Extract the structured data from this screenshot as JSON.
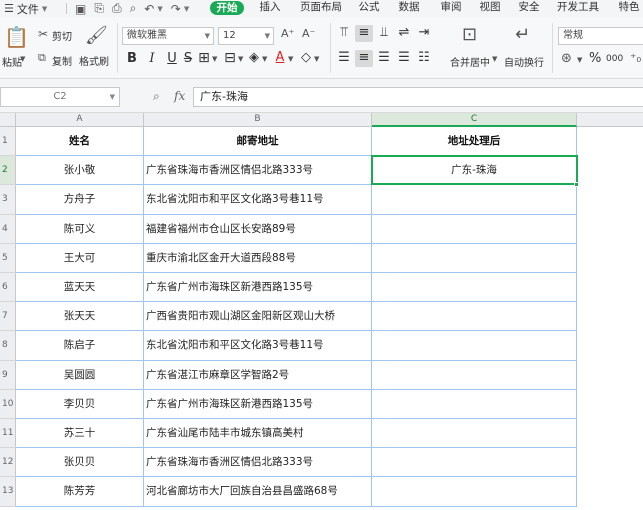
{
  "menubar": {
    "file_label": "文件",
    "tabs": [
      {
        "label": "开始",
        "active": true
      },
      {
        "label": "插入",
        "active": false
      },
      {
        "label": "页面布局",
        "active": false
      },
      {
        "label": "公式",
        "active": false
      },
      {
        "label": "数据",
        "active": false
      },
      {
        "label": "审阅",
        "active": false
      },
      {
        "label": "视图",
        "active": false
      },
      {
        "label": "安全",
        "active": false
      },
      {
        "label": "开发工具",
        "active": false
      },
      {
        "label": "特色",
        "active": false
      }
    ]
  },
  "ribbon": {
    "paste_label": "粘贴",
    "cut_label": "剪切",
    "copy_label": "复制",
    "format_painter_label": "格式刷",
    "font_name": "微软雅黑",
    "font_size": "12",
    "merge_label": "合并居中",
    "wrap_label": "自动换行",
    "number_format": "常规",
    "percent_symbol": "%",
    "thousands_symbol": "000",
    "bold": "B",
    "italic": "I",
    "underline": "U",
    "font_color_letter": "A"
  },
  "formula": {
    "name_box": "C2",
    "fx_label": "fx",
    "content": "广东-珠海"
  },
  "sheet": {
    "columns": [
      "A",
      "B",
      "C"
    ],
    "active_column": "C",
    "active_row": "2",
    "row_numbers": [
      "1",
      "2",
      "3",
      "4",
      "5",
      "6",
      "7",
      "8",
      "9",
      "10",
      "11",
      "12",
      "13"
    ],
    "header": {
      "name": "姓名",
      "address": "邮寄地址",
      "processed": "地址处理后"
    },
    "rows": [
      {
        "name": "张小敬",
        "address": "广东省珠海市香洲区情侣北路333号",
        "processed": "广东-珠海"
      },
      {
        "name": "方舟子",
        "address": "东北省沈阳市和平区文化路3号巷11号",
        "processed": ""
      },
      {
        "name": "陈可义",
        "address": "福建省福州市仓山区长安路89号",
        "processed": ""
      },
      {
        "name": "王大可",
        "address": "重庆市渝北区金开大道西段88号",
        "processed": ""
      },
      {
        "name": "蓝天天",
        "address": "广东省广州市海珠区新港西路135号",
        "processed": ""
      },
      {
        "name": "张天天",
        "address": "广西省贵阳市观山湖区金阳新区观山大桥",
        "processed": ""
      },
      {
        "name": "陈启子",
        "address": "东北省沈阳市和平区文化路3号巷11号",
        "processed": ""
      },
      {
        "name": "吴圆圆",
        "address": "广东省湛江市麻章区学智路2号",
        "processed": ""
      },
      {
        "name": "李贝贝",
        "address": "广东省广州市海珠区新港西路135号",
        "processed": ""
      },
      {
        "name": "苏三十",
        "address": "广东省汕尾市陆丰市城东镇高美村",
        "processed": ""
      },
      {
        "name": "张贝贝",
        "address": "广东省珠海市香洲区情侣北路333号",
        "processed": ""
      },
      {
        "name": "陈芳芳",
        "address": "河北省廊坊市大厂回族自治县昌盛路68号",
        "processed": ""
      }
    ]
  },
  "colors": {
    "accent": "#1aaa55",
    "grid_line": "#9fc6ef"
  }
}
